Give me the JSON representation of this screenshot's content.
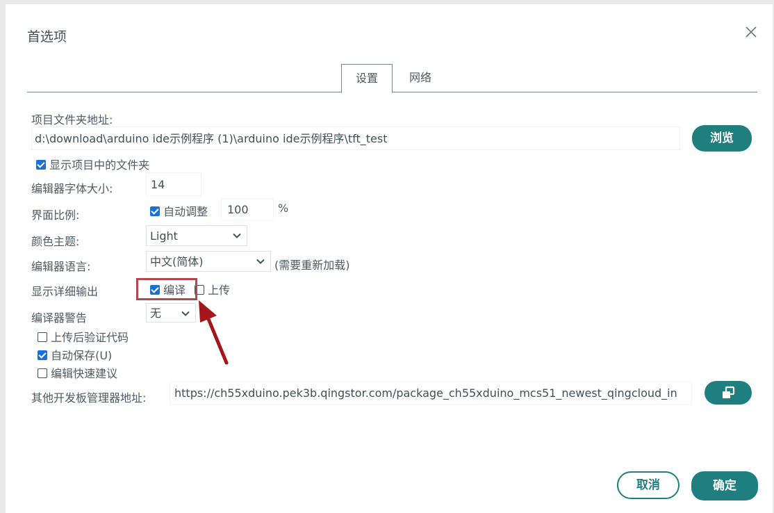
{
  "dialog": {
    "title": "首选项",
    "tabs": [
      {
        "label": "设置",
        "active": true
      },
      {
        "label": "网络",
        "active": false
      }
    ]
  },
  "sketchbook": {
    "label": "项目文件夹地址:",
    "value": "d:\\download\\arduino ide示例程序 (1)\\arduino ide示例程序\\tft_test",
    "browse_label": "浏览"
  },
  "show_files": {
    "label": "显示项目中的文件夹",
    "checked": true
  },
  "font_size": {
    "label": "编辑器字体大小:",
    "value": "14"
  },
  "scale": {
    "label": "界面比例:",
    "auto_label": "自动调整",
    "auto_checked": true,
    "value": "100",
    "unit": "%"
  },
  "theme": {
    "label": "颜色主题:",
    "value": "Light"
  },
  "language": {
    "label": "编辑器语言:",
    "value": "中文(简体)",
    "note": "(需要重新加载)"
  },
  "verbose": {
    "label": "显示详细输出",
    "compile_label": "编译",
    "compile_checked": true,
    "upload_label": "上传",
    "upload_checked": false
  },
  "warnings": {
    "label": "编译器警告",
    "value": "无"
  },
  "options": [
    {
      "label": "上传后验证代码",
      "checked": false
    },
    {
      "label": "自动保存(U)",
      "checked": true
    },
    {
      "label": "编辑快速建议",
      "checked": false
    }
  ],
  "board_urls": {
    "label": "其他开发板管理器地址:",
    "value": "https://ch55xduino.pek3b.qingstor.com/package_ch55xduino_mcs51_newest_qingcloud_in"
  },
  "footer": {
    "cancel_label": "取消",
    "ok_label": "确定"
  },
  "colors": {
    "accent": "#1f7e7e",
    "checkbox": "#1a6fd8",
    "highlight": "#b8454b",
    "arrow": "#a3161b"
  },
  "icons": [
    "close-icon",
    "checkbox-icon",
    "chevron-down-icon",
    "open-window-icon",
    "arrow-annotation"
  ]
}
